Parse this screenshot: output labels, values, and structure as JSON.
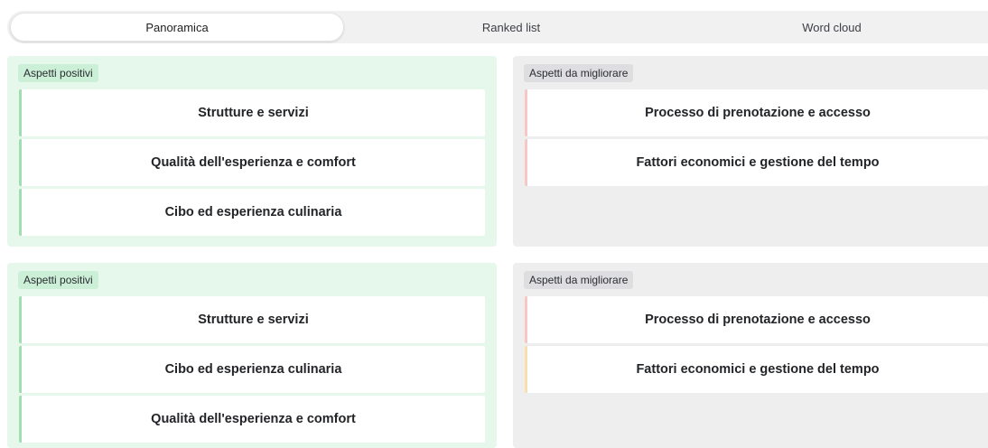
{
  "tabs": [
    {
      "label": "Panoramica",
      "selected": true
    },
    {
      "label": "Ranked list",
      "selected": false
    },
    {
      "label": "Word cloud",
      "selected": false
    }
  ],
  "sections": [
    {
      "positive": {
        "label": "Aspetti positivi",
        "items": [
          "Strutture e servizi",
          "Qualità dell'esperienza e comfort",
          "Cibo ed esperienza culinaria"
        ]
      },
      "negative": {
        "label": "Aspetti da migliorare",
        "items": [
          "Processo di prenotazione e accesso",
          "Fattori economici e gestione del tempo"
        ]
      }
    },
    {
      "positive": {
        "label": "Aspetti positivi",
        "items": [
          "Strutture e servizi",
          "Cibo ed esperienza culinaria",
          "Qualità dell'esperienza e comfort"
        ]
      },
      "negative": {
        "label": "Aspetti da migliorare",
        "items": [
          "Processo di prenotazione e accesso",
          "Fattori economici e gestione del tempo"
        ]
      }
    }
  ],
  "colors": {
    "positive_bg": "#e6f7ec",
    "positive_accent": "#9fddb2",
    "negative_bg": "#eeeeef",
    "negative_accent": "#f6c7c7",
    "warning_accent": "#f9dfb0"
  }
}
